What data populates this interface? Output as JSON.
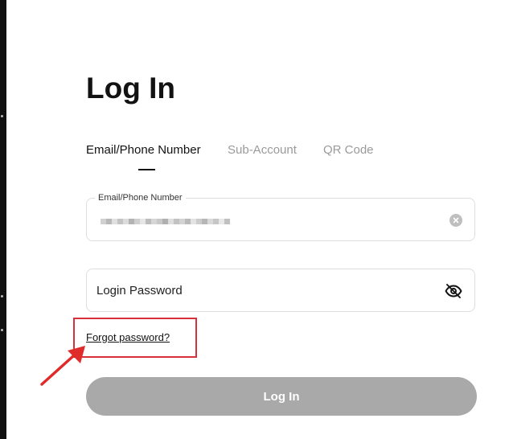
{
  "page": {
    "title": "Log In"
  },
  "tabs": [
    {
      "label": "Email/Phone Number",
      "active": true
    },
    {
      "label": "Sub-Account",
      "active": false
    },
    {
      "label": "QR Code",
      "active": false
    }
  ],
  "email_field": {
    "label": "Email/Phone Number",
    "value_state": "masked",
    "clear_icon": "clear-circle-icon"
  },
  "password_field": {
    "placeholder": "Login Password",
    "visibility_icon": "eye-off-icon"
  },
  "forgot_password": {
    "label": "Forgot password?"
  },
  "login_button": {
    "label": "Log In"
  },
  "colors": {
    "text_primary": "#121212",
    "tab_inactive": "#9a9a9a",
    "border": "#dedede",
    "button_disabled": "#a9a9a9",
    "annotation_red": "#d9313b"
  }
}
